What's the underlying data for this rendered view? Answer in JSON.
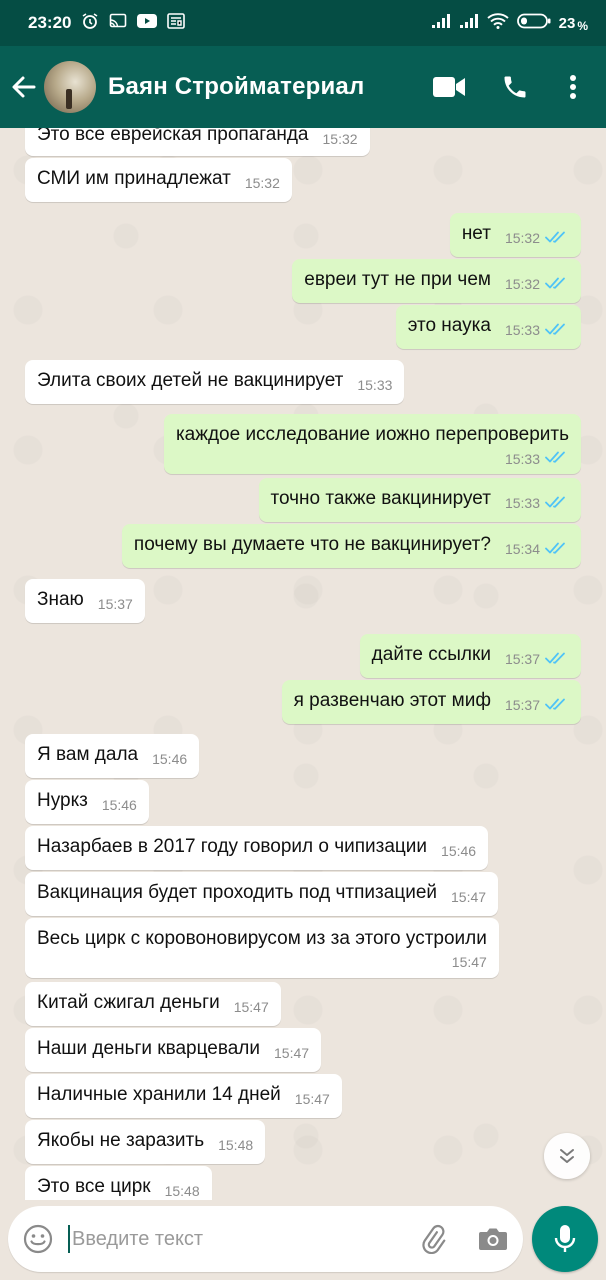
{
  "statusbar": {
    "time": "23:20",
    "battery": "23",
    "battery_unit": "%"
  },
  "header": {
    "contact_name": "Баян Стройматериал"
  },
  "messages": [
    {
      "text": "Это все еврейская пропаганда",
      "time": "15:32",
      "dir": "in"
    },
    {
      "text": "СМИ им принадлежат",
      "time": "15:32",
      "dir": "in"
    },
    {
      "text": "нет",
      "time": "15:32",
      "dir": "out"
    },
    {
      "text": "евреи тут не при чем",
      "time": "15:32",
      "dir": "out"
    },
    {
      "text": "это наука",
      "time": "15:33",
      "dir": "out"
    },
    {
      "text": "Элита своих детей не вакцинирует",
      "time": "15:33",
      "dir": "in"
    },
    {
      "text": "каждое исследование иожно перепроверить",
      "time": "15:33",
      "dir": "out"
    },
    {
      "text": "точно также вакцинирует",
      "time": "15:33",
      "dir": "out"
    },
    {
      "text": "почему вы думаете что не вакцинирует?",
      "time": "15:34",
      "dir": "out"
    },
    {
      "text": "Знаю",
      "time": "15:37",
      "dir": "in"
    },
    {
      "text": "дайте ссылки",
      "time": "15:37",
      "dir": "out"
    },
    {
      "text": "я развенчаю этот миф",
      "time": "15:37",
      "dir": "out"
    },
    {
      "text": "Я вам дала",
      "time": "15:46",
      "dir": "in"
    },
    {
      "text": "Нуркз",
      "time": "15:46",
      "dir": "in"
    },
    {
      "text": "Назарбаев в 2017 году говорил о чипизации",
      "time": "15:46",
      "dir": "in"
    },
    {
      "text": "Вакцинация будет проходить под чтпизацией",
      "time": "15:47",
      "dir": "in"
    },
    {
      "text": "Весь цирк с коровоновирусом из за этого устроили",
      "time": "15:47",
      "dir": "in"
    },
    {
      "text": "Китай сжигал деньги",
      "time": "15:47",
      "dir": "in"
    },
    {
      "text": "Наши деньги кварцевали",
      "time": "15:47",
      "dir": "in"
    },
    {
      "text": "Наличные хранили 14 дней",
      "time": "15:47",
      "dir": "in"
    },
    {
      "text": "Якобы не заразить",
      "time": "15:48",
      "dir": "in"
    },
    {
      "text": "Это все цирк",
      "time": "15:48",
      "dir": "in"
    }
  ],
  "composer": {
    "placeholder": "Введите текст"
  },
  "colors": {
    "header": "#075e54",
    "statusbar": "#054d44",
    "outgoing_bubble": "#dcf8c6",
    "incoming_bubble": "#ffffff",
    "read_ticks": "#4fc3f7",
    "fab": "#00897b"
  },
  "icons": {
    "back": "arrow-left-icon",
    "video": "video-camera-icon",
    "call": "phone-icon",
    "menu": "more-vert-icon",
    "emoji": "emoji-icon",
    "attach": "paperclip-icon",
    "camera": "camera-icon",
    "mic": "microphone-icon",
    "scroll_down": "double-chevron-down-icon"
  }
}
